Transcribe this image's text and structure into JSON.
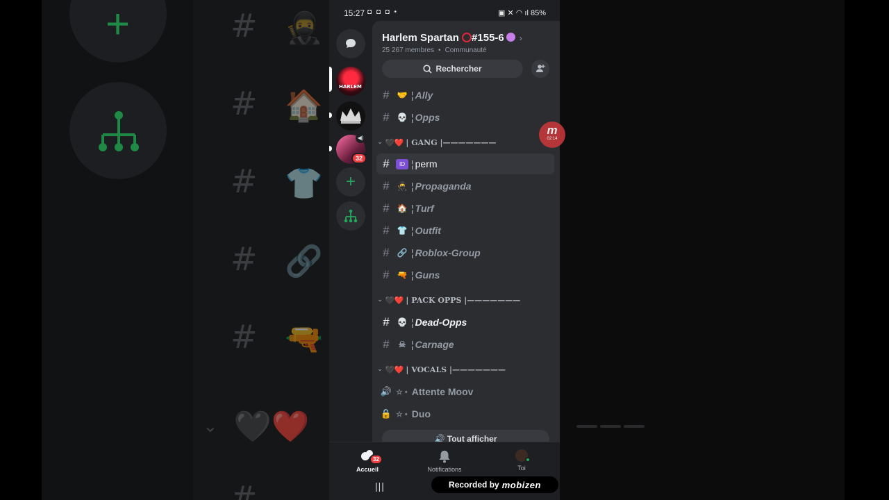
{
  "status_bar": {
    "time": "15:27",
    "left_icons": "◘ ◘ ◘ •",
    "battery": "85%",
    "right_icons": "▣ ✕ ◠ ıl"
  },
  "server": {
    "name": "Harlem Spartan",
    "name_suffix": "#155-6",
    "members": "25 267 membres",
    "type": "Communauté",
    "chevron": "›"
  },
  "search": {
    "placeholder": "Rechercher"
  },
  "rail": {
    "servers": [
      {
        "name": "HARLEM",
        "selected": true
      },
      {
        "name": "crown-server",
        "unread": true
      },
      {
        "name": "pink-server",
        "unread": true,
        "badge": "32"
      }
    ]
  },
  "channels": {
    "top": [
      {
        "icon": "🤝",
        "name": "Ally"
      },
      {
        "icon": "💀",
        "name": "Opps"
      }
    ],
    "gang_category": "| GANG |———————",
    "gang": [
      {
        "icon": "🆔",
        "name": "perm",
        "selected": true
      },
      {
        "icon": "🥷",
        "name": "Propaganda"
      },
      {
        "icon": "🏠",
        "name": "Turf"
      },
      {
        "icon": "👕",
        "name": "Outfit"
      },
      {
        "icon": "🔗",
        "name": "Roblox-Group"
      },
      {
        "icon": "🔫",
        "name": "Guns"
      }
    ],
    "pack_category": "| PACK OPPS |———————",
    "pack": [
      {
        "icon": "💀",
        "name": "Dead-Opps",
        "unread": true
      },
      {
        "icon": "☠",
        "name": "Carnage"
      }
    ],
    "vocals_category": "| VOCALS |———————",
    "vocals": [
      {
        "icon": "🔊",
        "name": "Attente Moov"
      },
      {
        "icon": "🔒",
        "name": "Duo"
      }
    ],
    "show_all": "Tout afficher"
  },
  "bottom_nav": {
    "home": "Accueil",
    "home_badge": "32",
    "notifications": "Notifications",
    "you": "Toi"
  },
  "watermark": {
    "prefix": "Recorded by",
    "brand": "mobizen"
  },
  "recorder_bubble": {
    "letter": "m",
    "time": "02:14"
  },
  "colors": {
    "accent_green": "#23a55a",
    "badge_red": "#f23f43",
    "panel": "#2b2d31",
    "rail": "#1e1f22"
  }
}
